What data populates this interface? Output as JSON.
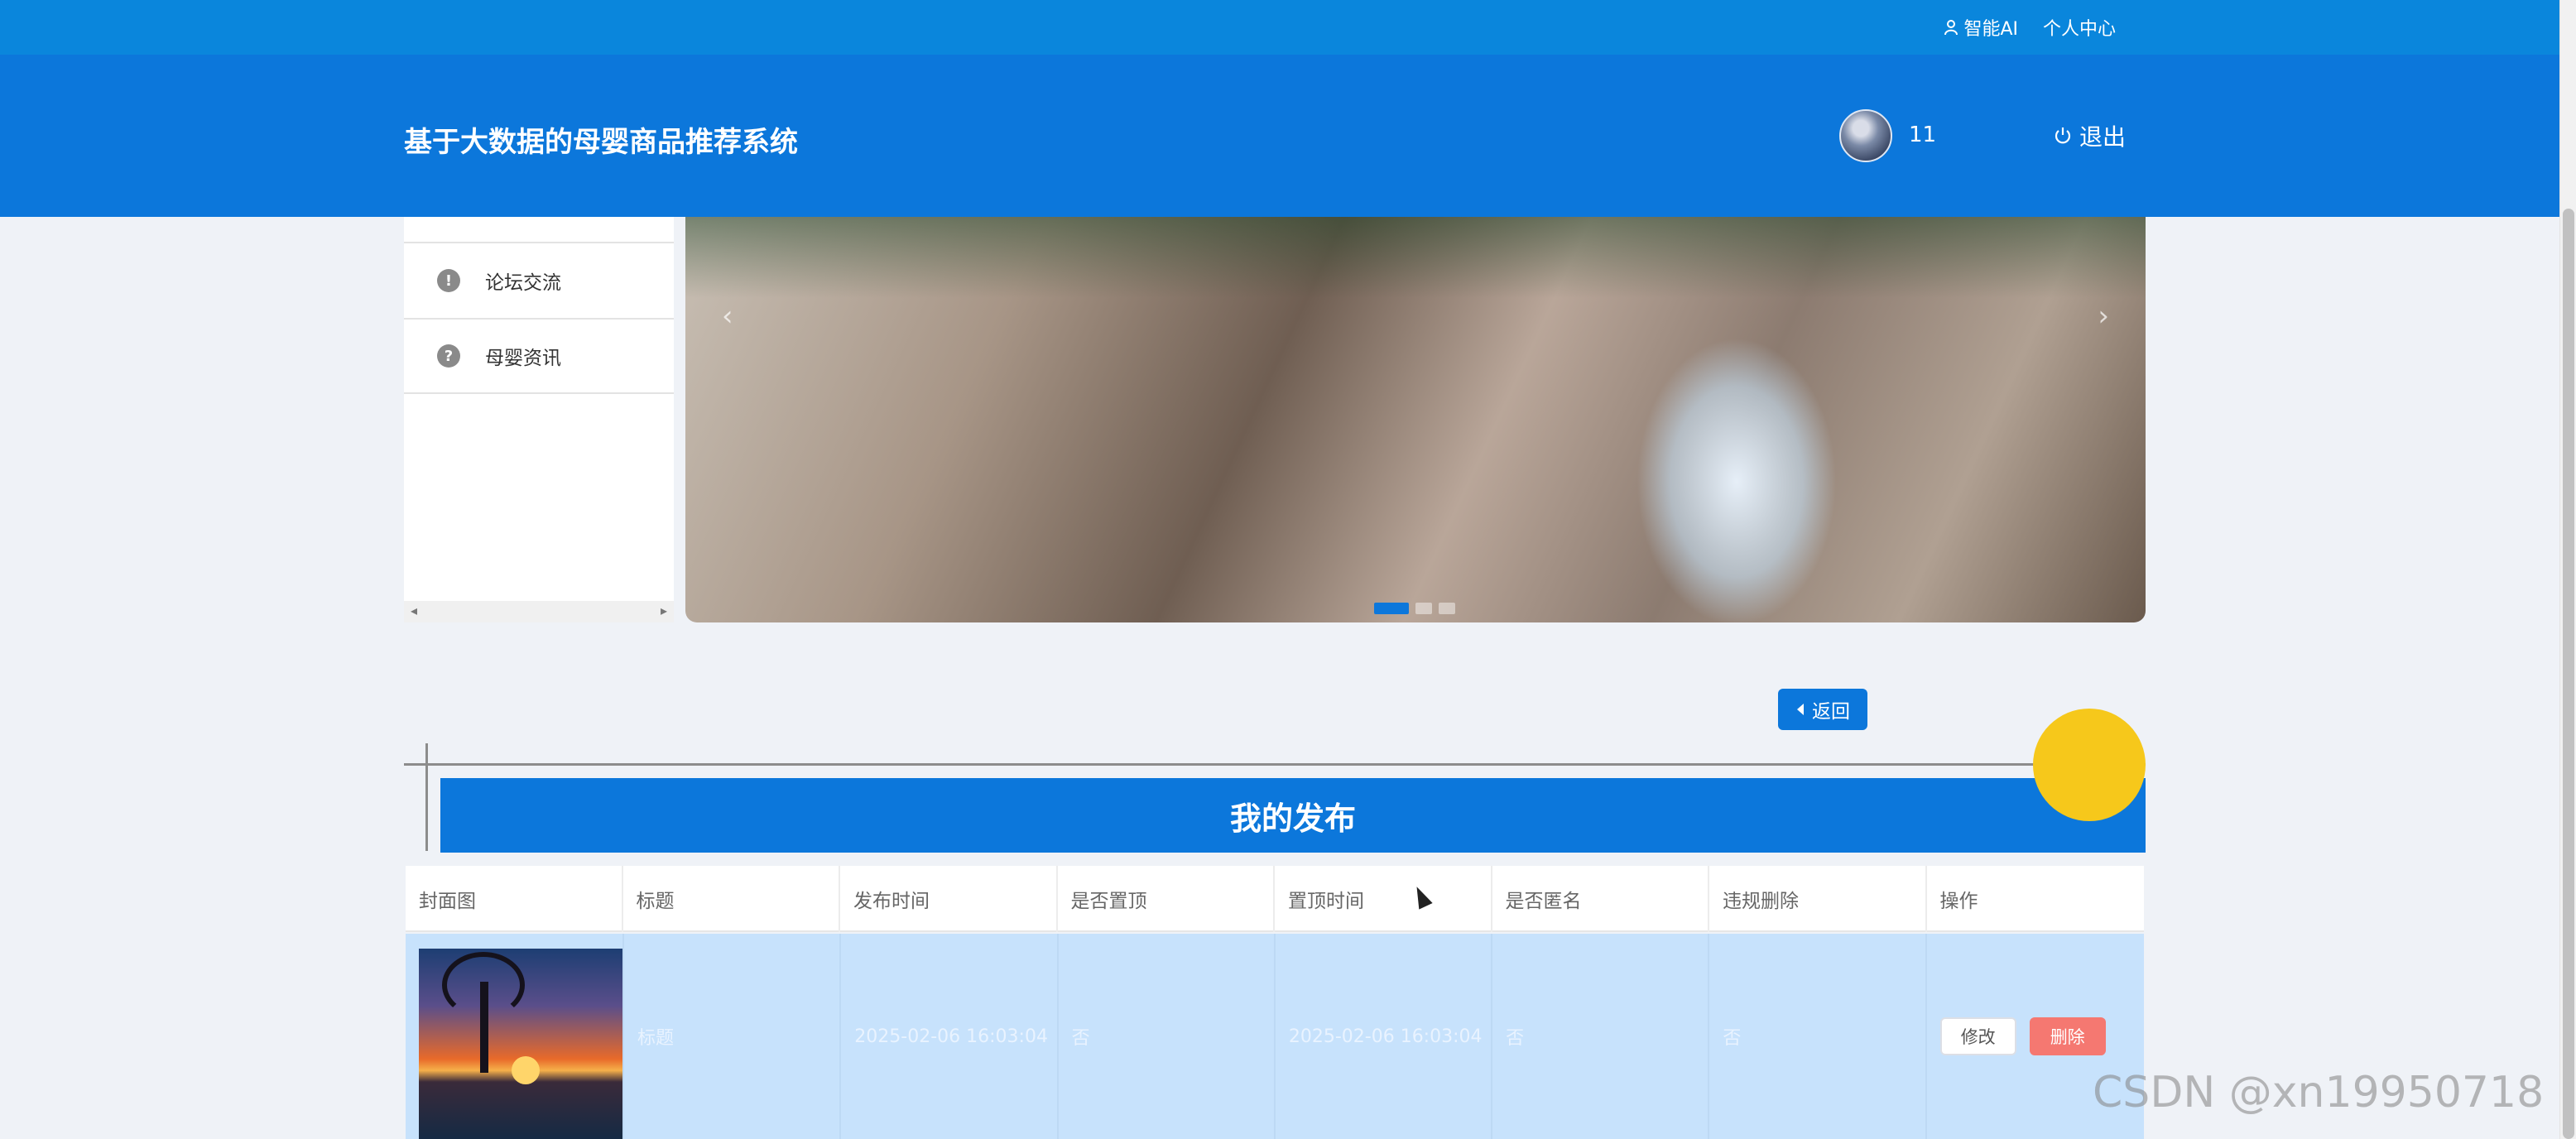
{
  "topbar": {
    "ai_label": "智能AI",
    "center_label": "个人中心"
  },
  "header": {
    "title": "基于大数据的母婴商品推荐系统",
    "username": "11",
    "logout_label": "退出"
  },
  "sidebar": {
    "items": [
      {
        "label": "论坛交流",
        "icon": "exclamation-icon"
      },
      {
        "label": "母婴资讯",
        "icon": "question-icon"
      }
    ]
  },
  "banner": {
    "slides": 3,
    "active_index": 0
  },
  "back_label": "返回",
  "section_title": "我的发布",
  "table": {
    "headers": [
      "封面图",
      "标题",
      "发布时间",
      "是否置顶",
      "置顶时间",
      "是否匿名",
      "违规删除",
      "操作"
    ],
    "rows": [
      {
        "title": "标题",
        "publish_time": "2025-02-06 16:03:04",
        "is_top": "否",
        "top_time": "2025-02-06 16:03:04",
        "anonymous": "否",
        "violation_deleted": "否",
        "edit_label": "修改",
        "delete_label": "删除"
      }
    ]
  },
  "watermark": "CSDN @xn19950718"
}
